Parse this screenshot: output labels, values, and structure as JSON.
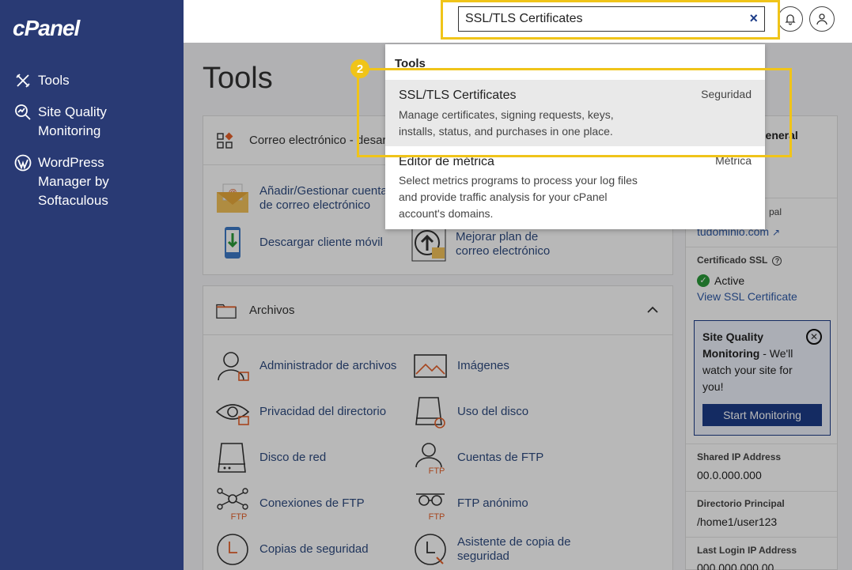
{
  "sidebar": {
    "logo": "cPanel",
    "items": [
      {
        "label": "Tools",
        "icon": "tools-icon"
      },
      {
        "label": "Site Quality Monitoring",
        "icon": "search-chart-icon"
      },
      {
        "label": "WordPress Manager by Softaculous",
        "icon": "wordpress-icon"
      }
    ]
  },
  "topbar": {
    "search_value": "SSL/TLS Certificates",
    "clear_symbol": "×"
  },
  "page": {
    "title": "Tools"
  },
  "email_card": {
    "header": "Correo electrónico - desarrollo",
    "tools": [
      {
        "label": "Añadir/Gestionar cuentas de correo electrónico"
      },
      {
        "label": "Descargar cliente móvil"
      },
      {
        "label": "Mejorar plan de correo electrónico"
      }
    ]
  },
  "files_card": {
    "header": "Archivos",
    "tools": [
      {
        "label": "Administrador de archivos"
      },
      {
        "label": "Imágenes"
      },
      {
        "label": "Privacidad del directorio"
      },
      {
        "label": "Uso del disco"
      },
      {
        "label": "Disco de red"
      },
      {
        "label": "Cuentas de FTP"
      },
      {
        "label": "Conexiones de FTP"
      },
      {
        "label": "FTP anónimo"
      },
      {
        "label": "Copias de seguridad"
      },
      {
        "label": "Asistente de copia de seguridad"
      }
    ],
    "ftp_tag": "FTP"
  },
  "right_panel": {
    "header_partial": "general",
    "domain_label_partial": "pal",
    "domain_value": "tudominio.com",
    "ssl_label": "Certificado SSL",
    "ssl_status": "Active",
    "ssl_link": "View SSL Certificate",
    "promo_title": "Site Quality Monitoring",
    "promo_text": " - We'll watch your site for you!",
    "promo_button": "Start Monitoring",
    "shared_ip_label": "Shared IP Address",
    "shared_ip_value": "00.0.000.000",
    "home_dir_label": "Directorio Principal",
    "home_dir_value": "/home1/user123",
    "last_login_label": "Last Login IP Address",
    "last_login_value": "000.000.000.00"
  },
  "dropdown": {
    "group": "Tools",
    "items": [
      {
        "title": "SSL/TLS Certificates",
        "description": "Manage certificates, signing requests, keys, installs, status, and purchases in one place.",
        "category": "Seguridad"
      },
      {
        "title": "Editor de métrica",
        "description": "Select metrics programs to process your log files and provide traffic analysis for your cPanel account's domains.",
        "category": "Métrica"
      }
    ]
  },
  "step_badge": "2",
  "colors": {
    "sidebar": "#293a74",
    "highlight": "#f0c419",
    "primary": "#1c3c88",
    "link": "#2f4b80"
  }
}
